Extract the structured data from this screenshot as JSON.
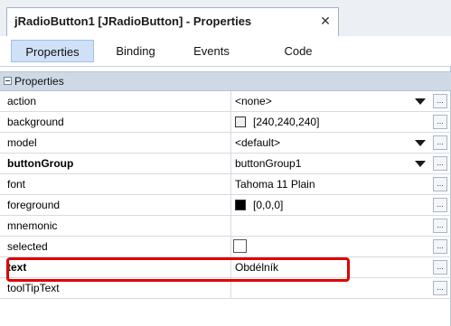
{
  "window": {
    "title": "jRadioButton1 [JRadioButton] - Properties",
    "close_glyph": "✕"
  },
  "tabs": [
    {
      "label": "Properties",
      "active": true
    },
    {
      "label": "Binding",
      "active": false
    },
    {
      "label": "Events",
      "active": false
    },
    {
      "label": "Code",
      "active": false
    }
  ],
  "section": {
    "label": "Properties",
    "expanded": true
  },
  "properties": [
    {
      "name": "action",
      "value": "<none>",
      "bold": false,
      "dropdown": true
    },
    {
      "name": "background",
      "value": "[240,240,240]",
      "bold": false,
      "swatch": "#f0f0f0"
    },
    {
      "name": "model",
      "value": "<default>",
      "bold": false,
      "dropdown": true
    },
    {
      "name": "buttonGroup",
      "value": "buttonGroup1",
      "bold": true,
      "dropdown": true
    },
    {
      "name": "font",
      "value": "Tahoma 11 Plain",
      "bold": false
    },
    {
      "name": "foreground",
      "value": "[0,0,0]",
      "bold": false,
      "swatch": "#000000"
    },
    {
      "name": "mnemonic",
      "value": "",
      "bold": false
    },
    {
      "name": "selected",
      "value": "",
      "bold": false,
      "checkbox": false
    },
    {
      "name": "text",
      "value": "Obdélník",
      "bold": true
    },
    {
      "name": "toolTipText",
      "value": "",
      "bold": false
    }
  ],
  "ellipsis_label": "...",
  "colors": {
    "highlight": "#e00000",
    "active_tab": "#cfe0f7",
    "section_bg": "#cfd9e6"
  }
}
